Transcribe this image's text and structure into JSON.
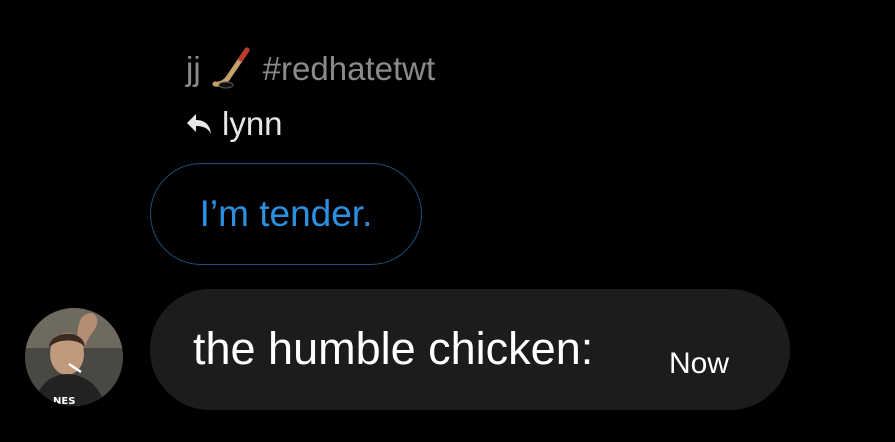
{
  "reply_header": {
    "sender_name": "jj",
    "emoji_icon": "ice-hockey-icon",
    "hashtag": "#redhatetwt"
  },
  "reply_to": {
    "icon": "reply-arrow-icon",
    "name": "lynn"
  },
  "quoted_message": {
    "text": "I’m tender.",
    "color": "#2c90e0",
    "border_color": "#1f4f7a"
  },
  "message": {
    "text": "the humble chicken:",
    "timestamp": "Now",
    "bubble_color": "#1c1c1e"
  },
  "colors": {
    "background": "#000000",
    "muted_text": "#8b8b8b"
  }
}
